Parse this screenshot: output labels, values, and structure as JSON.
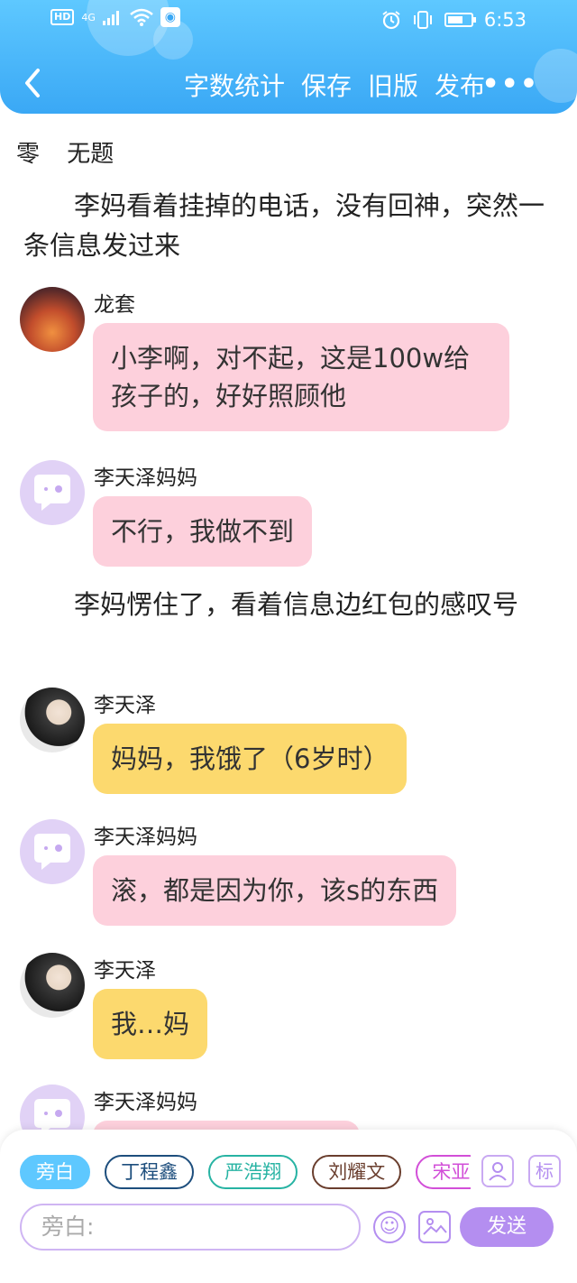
{
  "status_bar": {
    "network": "HD",
    "signal_type": "4G",
    "time": "6:53"
  },
  "navbar": {
    "back_icon": "chevron-left-icon",
    "actions": [
      "字数统计",
      "保存",
      "旧版",
      "发布"
    ],
    "more_icon": "more-dots-icon",
    "more_symbol": "•••"
  },
  "story": {
    "chapter": "零",
    "title": "无题",
    "blocks": [
      {
        "type": "narration",
        "text": "李妈看着挂掉的电话，没有回神，突然一条信息发过来"
      },
      {
        "type": "message",
        "name": "龙套",
        "avatar": "sunset-photo",
        "text": "小李啊，对不起，这是100w给孩子的，好好照顾他",
        "color": "#fdd0dc"
      },
      {
        "type": "message",
        "name": "李天泽妈妈",
        "avatar": "default-chat-avatar",
        "text": "不行，我做不到",
        "color": "#fdd0dc"
      },
      {
        "type": "narration",
        "text": "李妈愣住了，看着信息边红包的感叹号"
      },
      {
        "type": "message",
        "name": "李天泽",
        "avatar": "boy-photo",
        "text": "妈妈，我饿了（6岁时）",
        "color": "#fcd96e"
      },
      {
        "type": "message",
        "name": "李天泽妈妈",
        "avatar": "default-chat-avatar",
        "text": "滚，都是因为你，该s的东西",
        "color": "#fdd0dc"
      },
      {
        "type": "message",
        "name": "李天泽",
        "avatar": "boy-photo",
        "text": "我…妈",
        "color": "#fcd96e"
      },
      {
        "type": "message",
        "name": "李天泽妈妈",
        "avatar": "default-chat-avatar",
        "text": "",
        "color": "#fdd0dc"
      }
    ]
  },
  "input_panel": {
    "roles": [
      "旁白",
      "丁程鑫",
      "严浩翔",
      "刘耀文",
      "宋亚"
    ],
    "selected_role": "旁白",
    "character_button_icon": "person-icon",
    "tag_button_label": "标",
    "input_placeholder": "旁白:",
    "emoji_icon": "emoji-icon",
    "image_icon": "image-icon",
    "send_label": "发送"
  },
  "colors": {
    "header_blue": "#3aa8f5",
    "pink_bubble": "#fdd0dc",
    "yellow_bubble": "#fcd96e",
    "accent_purple": "#b48ef0"
  }
}
